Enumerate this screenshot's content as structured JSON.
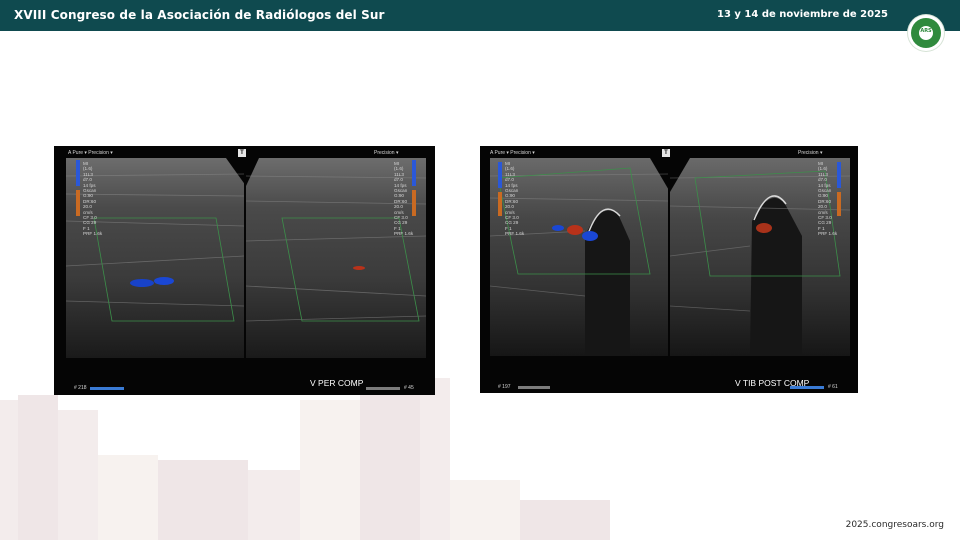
{
  "header": {
    "title": "XVIII Congreso de la Asociación de Radiólogos del Sur",
    "date": "13 y 14 de noviembre de 2025",
    "logo_text": "ARS",
    "background": "#0f4a4f"
  },
  "footer": {
    "url": "2025.congresoars.org"
  },
  "images": [
    {
      "caption": "V PER COMP",
      "frame_left": "# 218",
      "frame_right": "# 45",
      "top_left_label": "A Pure ▾  Precision ▾",
      "top_right_label": "Precision ▾",
      "readout_left": "MI\n(1.6)\n11L3\nd7.0\n14 fps\nGscan\nG:90\nDR:60\n20.0\ncm/s\nCF 3.0\nCG 29\nF 1\nPRF 1.6k",
      "readout_right": "MI\n(1.6)\n11L3\nd7.0\n14 fps\nGscan\nG:90\nDR:60\n20.0\ncm/s\nCF 3.0\nCG 29\nF 1\nPRF 1.6k",
      "marker": "T"
    },
    {
      "caption": "V TIB POST COMP",
      "frame_left": "# 197",
      "frame_right": "# 61",
      "top_left_label": "A Pure ▾  Precision ▾",
      "top_right_label": "Precision ▾",
      "readout_left": "MI\n(1.6)\n11L3\nd7.0\n14 fps\nGscan\nG:90\nDR:60\n20.0\ncm/s\nCF 3.0\nCG 29\nF 1\nPRF 1.6k",
      "readout_right": "MI\n(1.6)\n11L3\nd7.0\n14 fps\nGscan\nG:90\nDR:60\n20.0\ncm/s\nCF 3.0\nCG 29\nF 1\nPRF 1.6k",
      "marker": "T"
    }
  ]
}
